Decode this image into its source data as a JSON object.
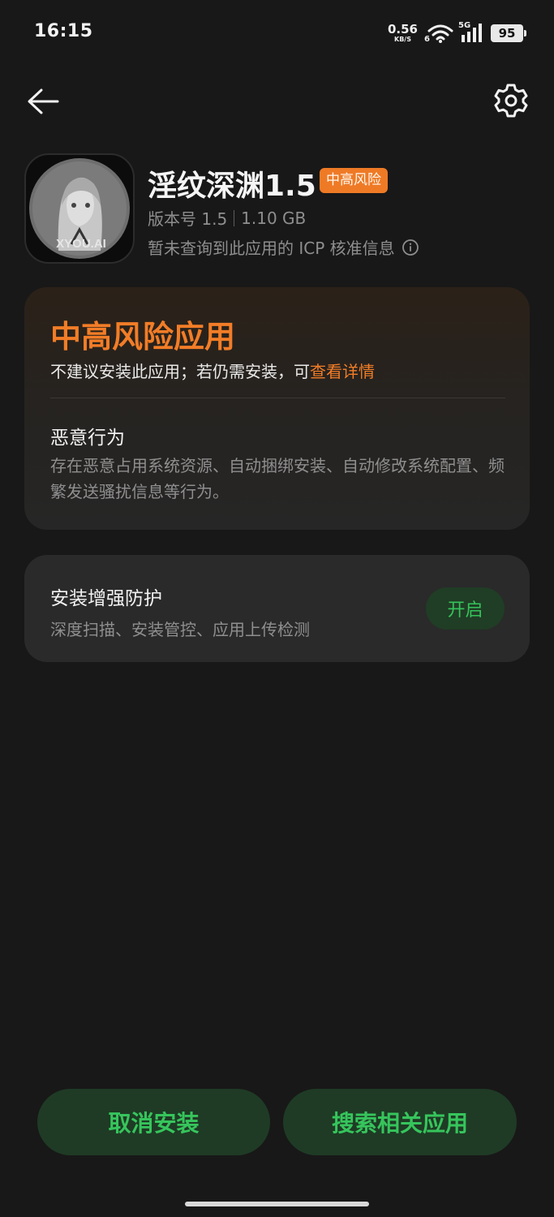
{
  "status_bar": {
    "time": "16:15",
    "net_speed_value": "0.56",
    "net_speed_unit": "KB/S",
    "wifi_label": "6",
    "cell_label": "5G",
    "battery": "95"
  },
  "nav": {
    "back_icon": "arrow-left-icon",
    "settings_icon": "gear-icon"
  },
  "app": {
    "name": "淫纹深渊1.5",
    "risk_tag": "中高风险",
    "version": "版本号 1.5",
    "size": "1.10 GB",
    "icp_notice": "暂未查询到此应用的 ICP 核准信息",
    "icon_text": "XYOU.AI"
  },
  "risk_card": {
    "title": "中高风险应用",
    "subtitle_prefix": "不建议安装此应用；若仍需安装，可",
    "subtitle_link": "查看详情",
    "malicious_title": "恶意行为",
    "malicious_desc": "存在恶意占用系统资源、自动捆绑安装、自动修改系统配置、频繁发送骚扰信息等行为。"
  },
  "protection": {
    "title": "安装增强防护",
    "desc": "深度扫描、安装管控、应用上传检测",
    "button": "开启"
  },
  "actions": {
    "cancel": "取消安装",
    "search": "搜索相关应用"
  },
  "colors": {
    "background": "#181818",
    "accent_orange": "#f27d27",
    "accent_green": "#36c55c",
    "green_button_bg": "#1f3b25"
  }
}
